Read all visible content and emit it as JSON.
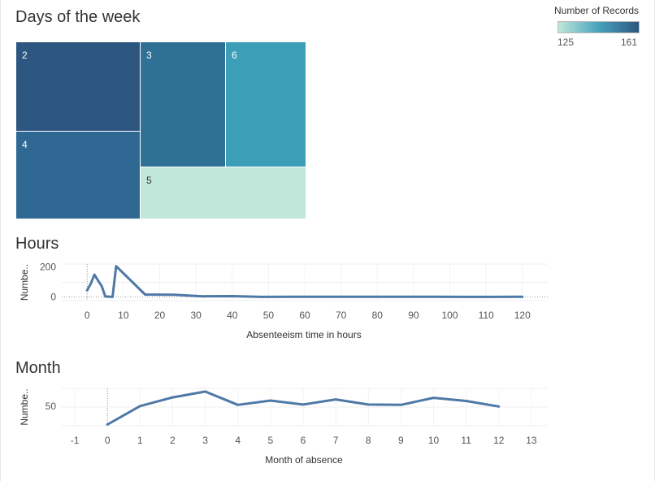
{
  "titles": {
    "days": "Days of the week",
    "hours": "Hours",
    "month": "Month"
  },
  "legend": {
    "title": "Number of Records",
    "min_label": "125",
    "max_label": "161",
    "min": 125,
    "max": 161,
    "color_low": "#c0e7da",
    "color_mid": "#47a3bd",
    "color_high": "#2d5680"
  },
  "chart_data": [
    {
      "type": "treemap",
      "title": "Days of the week",
      "color_legend": "Number of Records",
      "items": [
        {
          "label": "2",
          "value": 161,
          "color": "#2d5680"
        },
        {
          "label": "4",
          "value": 156,
          "color": "#2f6893"
        },
        {
          "label": "3",
          "value": 154,
          "color": "#2f7195"
        },
        {
          "label": "6",
          "value": 144,
          "color": "#3d9eb8"
        },
        {
          "label": "5",
          "value": 125,
          "color": "#c0e7da"
        }
      ]
    },
    {
      "type": "line",
      "title": "Hours",
      "xlabel": "Absenteeism time in hours",
      "ylabel": "Numbe..",
      "xlim": [
        -7,
        127
      ],
      "ylim": [
        -25,
        220
      ],
      "xticks": [
        0,
        10,
        20,
        30,
        40,
        50,
        60,
        70,
        80,
        90,
        100,
        110,
        120
      ],
      "yticks": [
        0,
        200
      ],
      "line_color": "#4e79a7",
      "x": [
        0,
        1,
        2,
        3,
        4,
        5,
        7,
        8,
        16,
        24,
        32,
        40,
        48,
        56,
        64,
        72,
        80,
        88,
        96,
        104,
        112,
        120
      ],
      "y": [
        44,
        88,
        149,
        110,
        73,
        3,
        0,
        206,
        16,
        14,
        4,
        5,
        0,
        1,
        1,
        1,
        1,
        1,
        1,
        0,
        0,
        1
      ]
    },
    {
      "type": "line",
      "title": "Month",
      "xlabel": "Month of absence",
      "ylabel": "Numbe..",
      "xlim": [
        -1.4,
        13.5
      ],
      "ylim": [
        0,
        95
      ],
      "xticks": [
        -1,
        0,
        1,
        2,
        3,
        4,
        5,
        6,
        7,
        8,
        9,
        10,
        11,
        12,
        13
      ],
      "yticks": [
        50
      ],
      "line_color": "#4e79a7",
      "x": [
        0,
        1,
        2,
        3,
        4,
        5,
        6,
        7,
        8,
        9,
        10,
        11,
        12
      ],
      "y": [
        3,
        50,
        72,
        87,
        53,
        64,
        54,
        67,
        54,
        53,
        71,
        63,
        49
      ]
    }
  ]
}
